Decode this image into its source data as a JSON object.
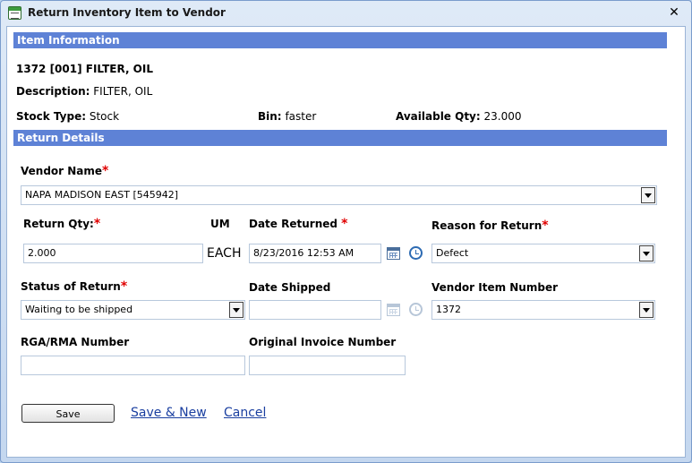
{
  "window": {
    "title": "Return Inventory Item to Vendor",
    "close_glyph": "✕"
  },
  "item_info": {
    "header": "Item Information",
    "item_title": "1372 [001] FILTER, OIL",
    "description_label": "Description:",
    "description_value": "FILTER, OIL",
    "stock_type_label": "Stock Type:",
    "stock_type_value": "Stock",
    "bin_label": "Bin:",
    "bin_value": "faster",
    "available_qty_label": "Available Qty:",
    "available_qty_value": "23.000"
  },
  "return_details": {
    "header": "Return Details",
    "required_marker": "*",
    "vendor_name": {
      "label": "Vendor Name",
      "value": "NAPA MADISON EAST [545942]"
    },
    "return_qty": {
      "label": "Return Qty:",
      "value": "2.000"
    },
    "um": {
      "label": "UM",
      "value": "EACH"
    },
    "date_returned": {
      "label": "Date Returned",
      "value": "8/23/2016 12:53 AM"
    },
    "reason_for_return": {
      "label": "Reason for Return",
      "value": "Defect"
    },
    "status_of_return": {
      "label": "Status of Return",
      "value": "Waiting to be shipped"
    },
    "date_shipped": {
      "label": "Date Shipped",
      "value": ""
    },
    "vendor_item_number": {
      "label": "Vendor Item Number",
      "value": "1372"
    },
    "rga_rma_number": {
      "label": "RGA/RMA Number",
      "value": ""
    },
    "original_invoice_number": {
      "label": "Original Invoice Number",
      "value": ""
    }
  },
  "actions": {
    "save_label": "Save",
    "save_new_label": "Save & New",
    "cancel_label": "Cancel"
  },
  "colors": {
    "section_bar": "#5e82d6",
    "required": "#e00000",
    "link": "#1a3fa0"
  }
}
